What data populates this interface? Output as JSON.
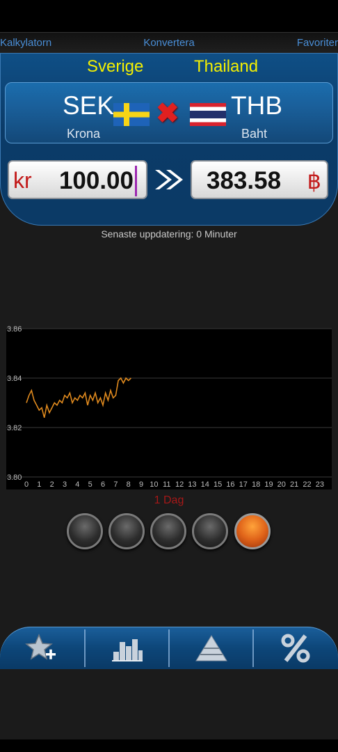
{
  "tabs": {
    "left": "Kalkylatorn",
    "center": "Konvertera",
    "right": "Favoriter"
  },
  "from": {
    "country": "Sverige",
    "code": "SEK",
    "name": "Krona",
    "symbol": "kr",
    "amount": "100.00",
    "flag": "sweden-flag"
  },
  "to": {
    "country": "Thailand",
    "code": "THB",
    "name": "Baht",
    "symbol": "฿",
    "amount": "383.58",
    "flag": "thailand-flag"
  },
  "update_text": "Senaste uppdatering: 0 Minuter",
  "period_label": "1 Dag",
  "period_buttons": [
    "period-1",
    "period-2",
    "period-3",
    "period-4",
    "period-5"
  ],
  "active_period": 4,
  "colors": {
    "accent": "#f4f000",
    "line": "#e08a1e",
    "red": "#c21a1a",
    "blue": "#0d4679"
  },
  "nav": [
    "add-favorite-icon",
    "chart-icon",
    "pyramid-icon",
    "percent-icon"
  ],
  "chart_data": {
    "type": "line",
    "ylim": [
      3.8,
      3.86
    ],
    "yticks": [
      "3.80",
      "3.82",
      "3.84",
      "3.86"
    ],
    "xlim": [
      0,
      23.5
    ],
    "xticks": [
      "0",
      "1",
      "2",
      "3",
      "4",
      "5",
      "6",
      "7",
      "8",
      "9",
      "10",
      "11",
      "12",
      "13",
      "14",
      "15",
      "16",
      "17",
      "18",
      "19",
      "20",
      "21",
      "22",
      "23"
    ],
    "grid": true,
    "series": [
      {
        "x": [
          0,
          0.2,
          0.4,
          0.6,
          0.8,
          1.0,
          1.2,
          1.4,
          1.6,
          1.8,
          2.0,
          2.2,
          2.4,
          2.6,
          2.8,
          3.0,
          3.2,
          3.4,
          3.6,
          3.8,
          4.0,
          4.2,
          4.4,
          4.6,
          4.8,
          5.0,
          5.2,
          5.4,
          5.6,
          5.8,
          6.0,
          6.2,
          6.4,
          6.6,
          6.8,
          7.0,
          7.2,
          7.4,
          7.6,
          7.8,
          8.0,
          8.2
        ],
        "y": [
          3.83,
          3.833,
          3.835,
          3.831,
          3.829,
          3.827,
          3.828,
          3.824,
          3.829,
          3.826,
          3.828,
          3.83,
          3.829,
          3.831,
          3.83,
          3.833,
          3.832,
          3.834,
          3.83,
          3.832,
          3.831,
          3.833,
          3.832,
          3.834,
          3.829,
          3.833,
          3.831,
          3.834,
          3.83,
          3.832,
          3.829,
          3.834,
          3.831,
          3.835,
          3.832,
          3.833,
          3.839,
          3.84,
          3.838,
          3.84,
          3.839,
          3.84
        ]
      }
    ]
  }
}
